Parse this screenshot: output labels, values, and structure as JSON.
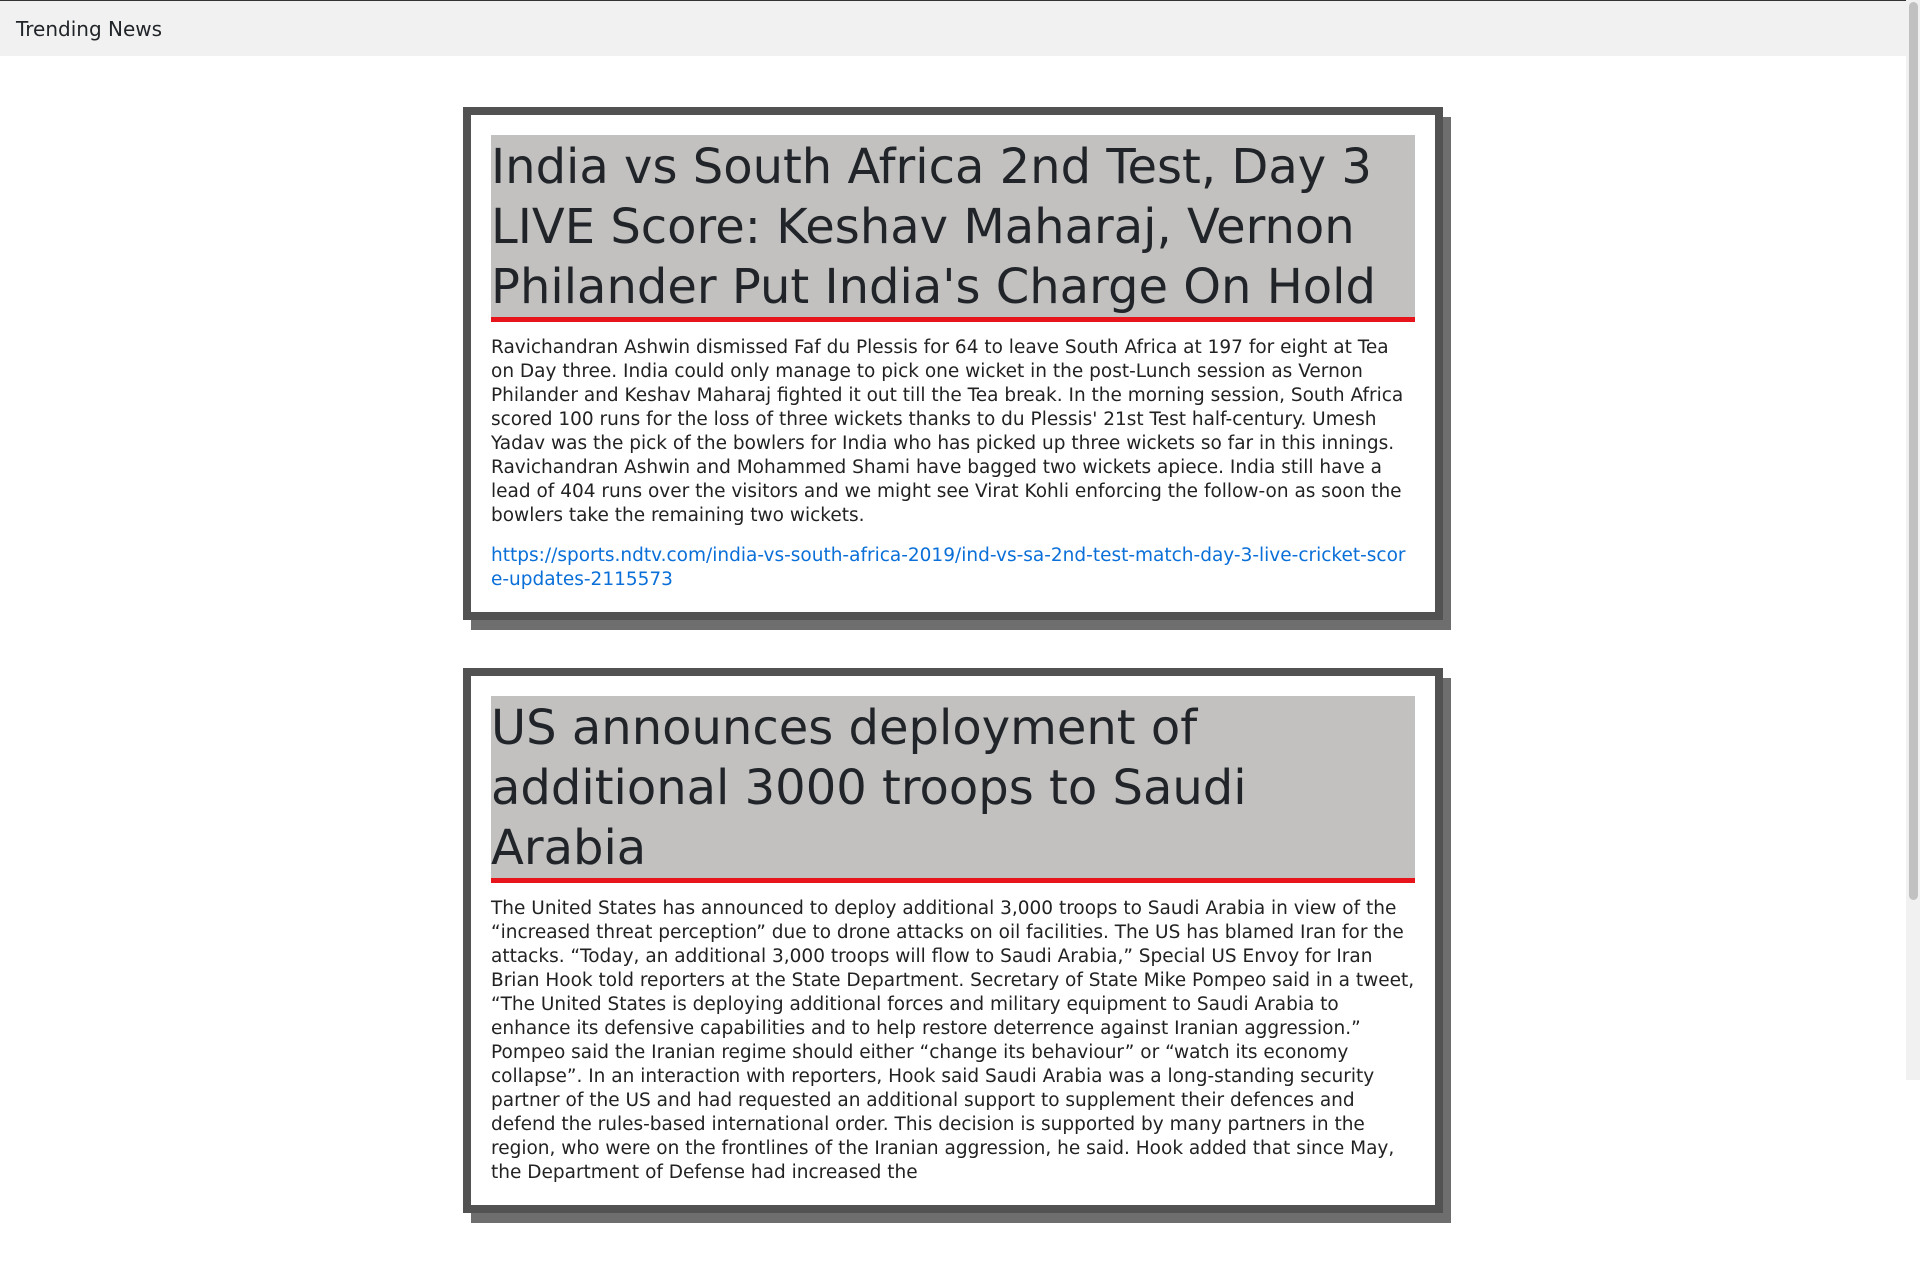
{
  "header": {
    "brand": "Trending News"
  },
  "articles": [
    {
      "title": "India vs South Africa 2nd Test, Day 3 LIVE Score: Keshav Maharaj, Vernon Philander Put India's Charge On Hold",
      "text": "Ravichandran Ashwin dismissed Faf du Plessis for 64 to leave South Africa at 197 for eight at Tea on Day three. India could only manage to pick one wicket in the post-Lunch session as Vernon Philander and Keshav Maharaj fighted it out till the Tea break. In the morning session, South Africa scored 100 runs for the loss of three wickets thanks to du Plessis' 21st Test half-century. Umesh Yadav was the pick of the bowlers for India who has picked up three wickets so far in this innings. Ravichandran Ashwin and Mohammed Shami have bagged two wickets apiece. India still have a lead of 404 runs over the visitors and we might see Virat Kohli enforcing the follow-on as soon the bowlers take the remaining two wickets.",
      "link": "https://sports.ndtv.com/india-vs-south-africa-2019/ind-vs-sa-2nd-test-match-day-3-live-cricket-score-updates-2115573"
    },
    {
      "title": "US announces deployment of additional 3000 troops to Saudi Arabia",
      "text": "The United States has announced to deploy additional 3,000 troops to Saudi Arabia in view of the “increased threat perception” due to drone attacks on oil facilities. The US has blamed Iran for the attacks. “Today, an additional 3,000 troops will flow to Saudi Arabia,” Special US Envoy for Iran Brian Hook told reporters at the State Department. Secretary of State Mike Pompeo said in a tweet, “The United States is deploying additional forces and military equipment to Saudi Arabia to enhance its defensive capabilities and to help restore deterrence against Iranian aggression.” Pompeo said the Iranian regime should either “change its behaviour” or “watch its economy collapse”. In an interaction with reporters, Hook said Saudi Arabia was a long-standing security partner of the US and had requested an additional support to supplement their defences and defend the rules-based international order. This decision is supported by many partners in the region, who were on the frontlines of the Iranian aggression, he said. Hook added that since May, the Department of Defense had increased the"
    }
  ],
  "colors": {
    "title_bg": "#c2c1c0",
    "title_underline": "#e8141c",
    "card_border": "#525252",
    "link": "#0a6fd8"
  }
}
